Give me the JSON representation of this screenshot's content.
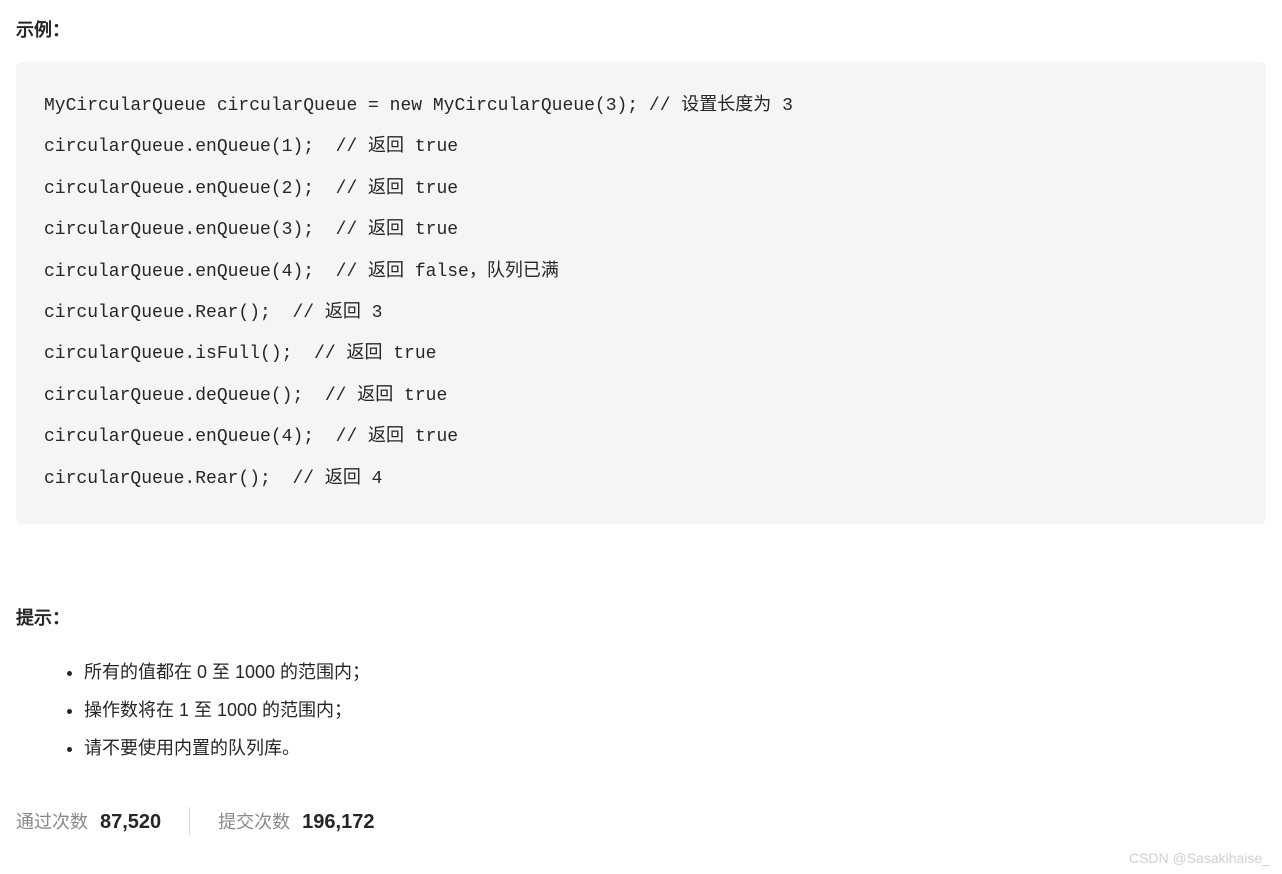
{
  "example": {
    "title": "示例：",
    "code": "MyCircularQueue circularQueue = new MyCircularQueue(3); // 设置长度为 3\ncircularQueue.enQueue(1);  // 返回 true\ncircularQueue.enQueue(2);  // 返回 true\ncircularQueue.enQueue(3);  // 返回 true\ncircularQueue.enQueue(4);  // 返回 false，队列已满\ncircularQueue.Rear();  // 返回 3\ncircularQueue.isFull();  // 返回 true\ncircularQueue.deQueue();  // 返回 true\ncircularQueue.enQueue(4);  // 返回 true\ncircularQueue.Rear();  // 返回 4"
  },
  "hints": {
    "title": "提示：",
    "items": [
      "所有的值都在 0 至 1000 的范围内；",
      "操作数将在 1 至 1000 的范围内；",
      "请不要使用内置的队列库。"
    ]
  },
  "stats": {
    "accepted_label": "通过次数",
    "accepted_value": "87,520",
    "submissions_label": "提交次数",
    "submissions_value": "196,172"
  },
  "watermark": "CSDN @Sasakihaise_"
}
